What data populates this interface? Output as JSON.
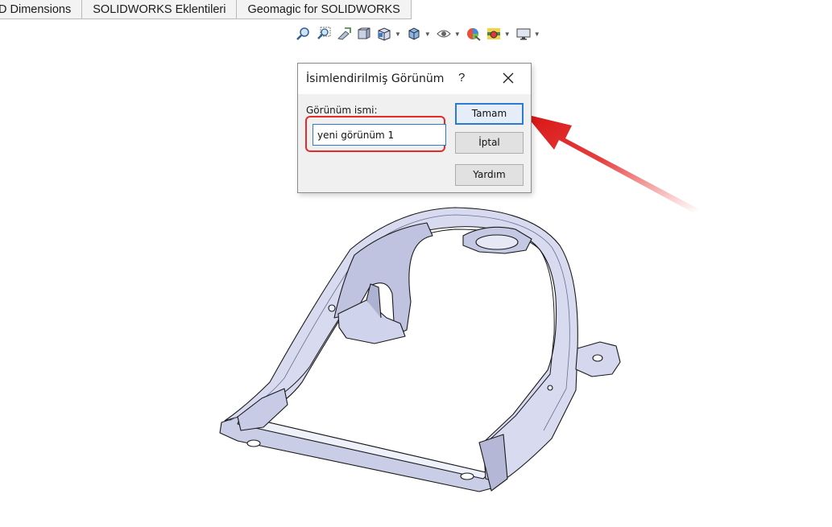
{
  "tabs": [
    {
      "label": "D Dimensions"
    },
    {
      "label": "SOLIDWORKS Eklentileri"
    },
    {
      "label": "Geomagic for SOLIDWORKS"
    }
  ],
  "toolbar": {
    "icons": [
      "zoom-to-fit-icon",
      "zoom-to-area-icon",
      "previous-view-icon",
      "section-view-icon",
      "view-orientation-icon",
      "display-style-icon",
      "hide-show-items-icon",
      "edit-appearance-icon",
      "apply-scene-icon",
      "view-settings-icon"
    ]
  },
  "dialog": {
    "title": "İsimlendirilmiş Görünüm",
    "help_symbol": "?",
    "field_label": "Görünüm ismi:",
    "field_value": "yeni görünüm 1",
    "ok_label": "Tamam",
    "cancel_label": "İptal",
    "help_label": "Yardım"
  },
  "colors": {
    "highlight": "#e52a2a",
    "focus": "#2b7bd6",
    "model_face": "#d8dbf0",
    "model_edge": "#1a1a1a"
  }
}
